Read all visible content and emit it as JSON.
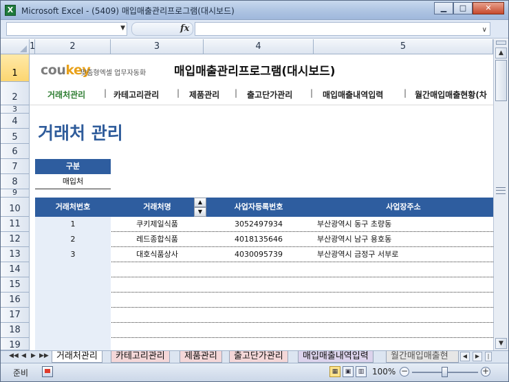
{
  "window": {
    "app_icon": "X",
    "title": "Microsoft Excel - (5409) 매입매출관리프로그램(대시보드)",
    "minimize": "▁",
    "maximize": "□",
    "close": "✕"
  },
  "formula_bar": {
    "fx": "fx",
    "name_dropdown": "▼",
    "expand": "∨"
  },
  "columns": [
    "1",
    "2",
    "3",
    "4",
    "5"
  ],
  "rows": [
    "1",
    "2",
    "3",
    "4",
    "5",
    "6",
    "7",
    "8",
    "9",
    "10",
    "11",
    "12",
    "13",
    "14",
    "15",
    "16",
    "17",
    "18",
    "19"
  ],
  "brand": {
    "logo_main": "cou",
    "logo_accent": "key",
    "tagline": "맞춤형엑셀 업무자동화",
    "app_title": "매입매출관리프로그램(대시보드)"
  },
  "nav": {
    "items": [
      "거래처관리",
      "카테고리관리",
      "제품관리",
      "출고단가관리",
      "매입매출내역입력",
      "월간매입매출현황(차"
    ],
    "separator": "|",
    "active_index": 0
  },
  "section_title": "거래처 관리",
  "category": {
    "header": "구분",
    "value": "매입처"
  },
  "table": {
    "headers": [
      "거래처번호",
      "거래처명",
      "사업자등록번호",
      "사업장주소"
    ],
    "rows": [
      [
        "1",
        "쿠키제일식품",
        "3052497934",
        "부산광역시 동구 초량동"
      ],
      [
        "2",
        "레드종합식품",
        "4018135646",
        "부산광역시 남구 용호동"
      ],
      [
        "3",
        "대호식품상사",
        "4030095739",
        "부산광역시 금정구 서부로"
      ]
    ],
    "spinner_up": "▲",
    "spinner_down": "▼"
  },
  "sheet_tabs": {
    "nav": [
      "◀◀",
      "◀",
      "▶",
      "▶▶"
    ],
    "tabs": [
      "거래처관리",
      "카테고리관리",
      "제품관리",
      "출고단가관리",
      "매입매출내역입력",
      "월간매입매출현"
    ],
    "active_index": 0
  },
  "status": {
    "ready": "준비",
    "zoom": "100%",
    "zoom_minus": "−",
    "zoom_plus": "+"
  },
  "colors": {
    "header_blue": "#2e5d9f",
    "title_blue": "#2f5c9b",
    "active_nav_green": "#2e7d32",
    "logo_orange": "#e8a11a"
  }
}
